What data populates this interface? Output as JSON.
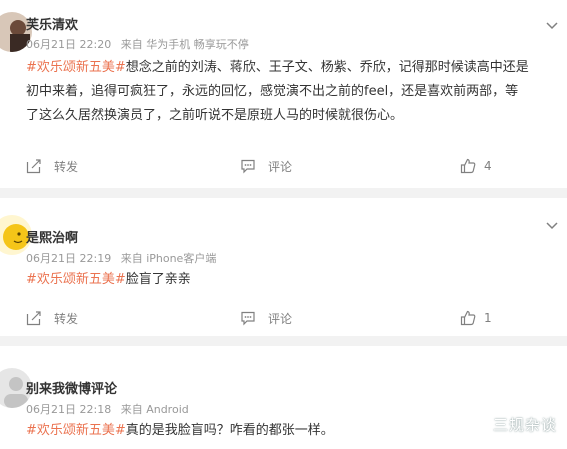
{
  "posts": [
    {
      "username": "芙乐清欢",
      "date": "06月21日 22:20",
      "source": "来自 华为手机 畅享玩不停",
      "topic": "#欢乐颂新五美#",
      "text_line1": "想念之前的刘涛、蒋欣、王子文、杨紫、乔欣，记得那时候读高中还是",
      "text_line2": "初中来着，追得可疯狂了，永远的回忆，感觉演不出之前的feel，还是喜欢前两部，等",
      "text_line3": "了这么久居然换演员了，之前听说不是原班人马的时候就很伤心。",
      "forward_label": "转发",
      "comment_label": "评论",
      "like_count": "4"
    },
    {
      "username": "是熙治啊",
      "date": "06月21日 22:19",
      "source": "来自 iPhone客户端",
      "topic": "#欢乐颂新五美#",
      "text_line1": "脸盲了亲亲",
      "forward_label": "转发",
      "comment_label": "评论",
      "like_count": "1"
    },
    {
      "username": "别来我微博评论",
      "date": "06月21日 22:18",
      "source": "来自 Android",
      "topic": "#欢乐颂新五美#",
      "text_line1": "真的是我脸盲吗？咋看的都张一样。"
    }
  ],
  "watermark": "三规杂谈",
  "colors": {
    "topic": "#eb7350",
    "meta": "#999999",
    "action": "#808080",
    "background": "#f2f2f2"
  }
}
